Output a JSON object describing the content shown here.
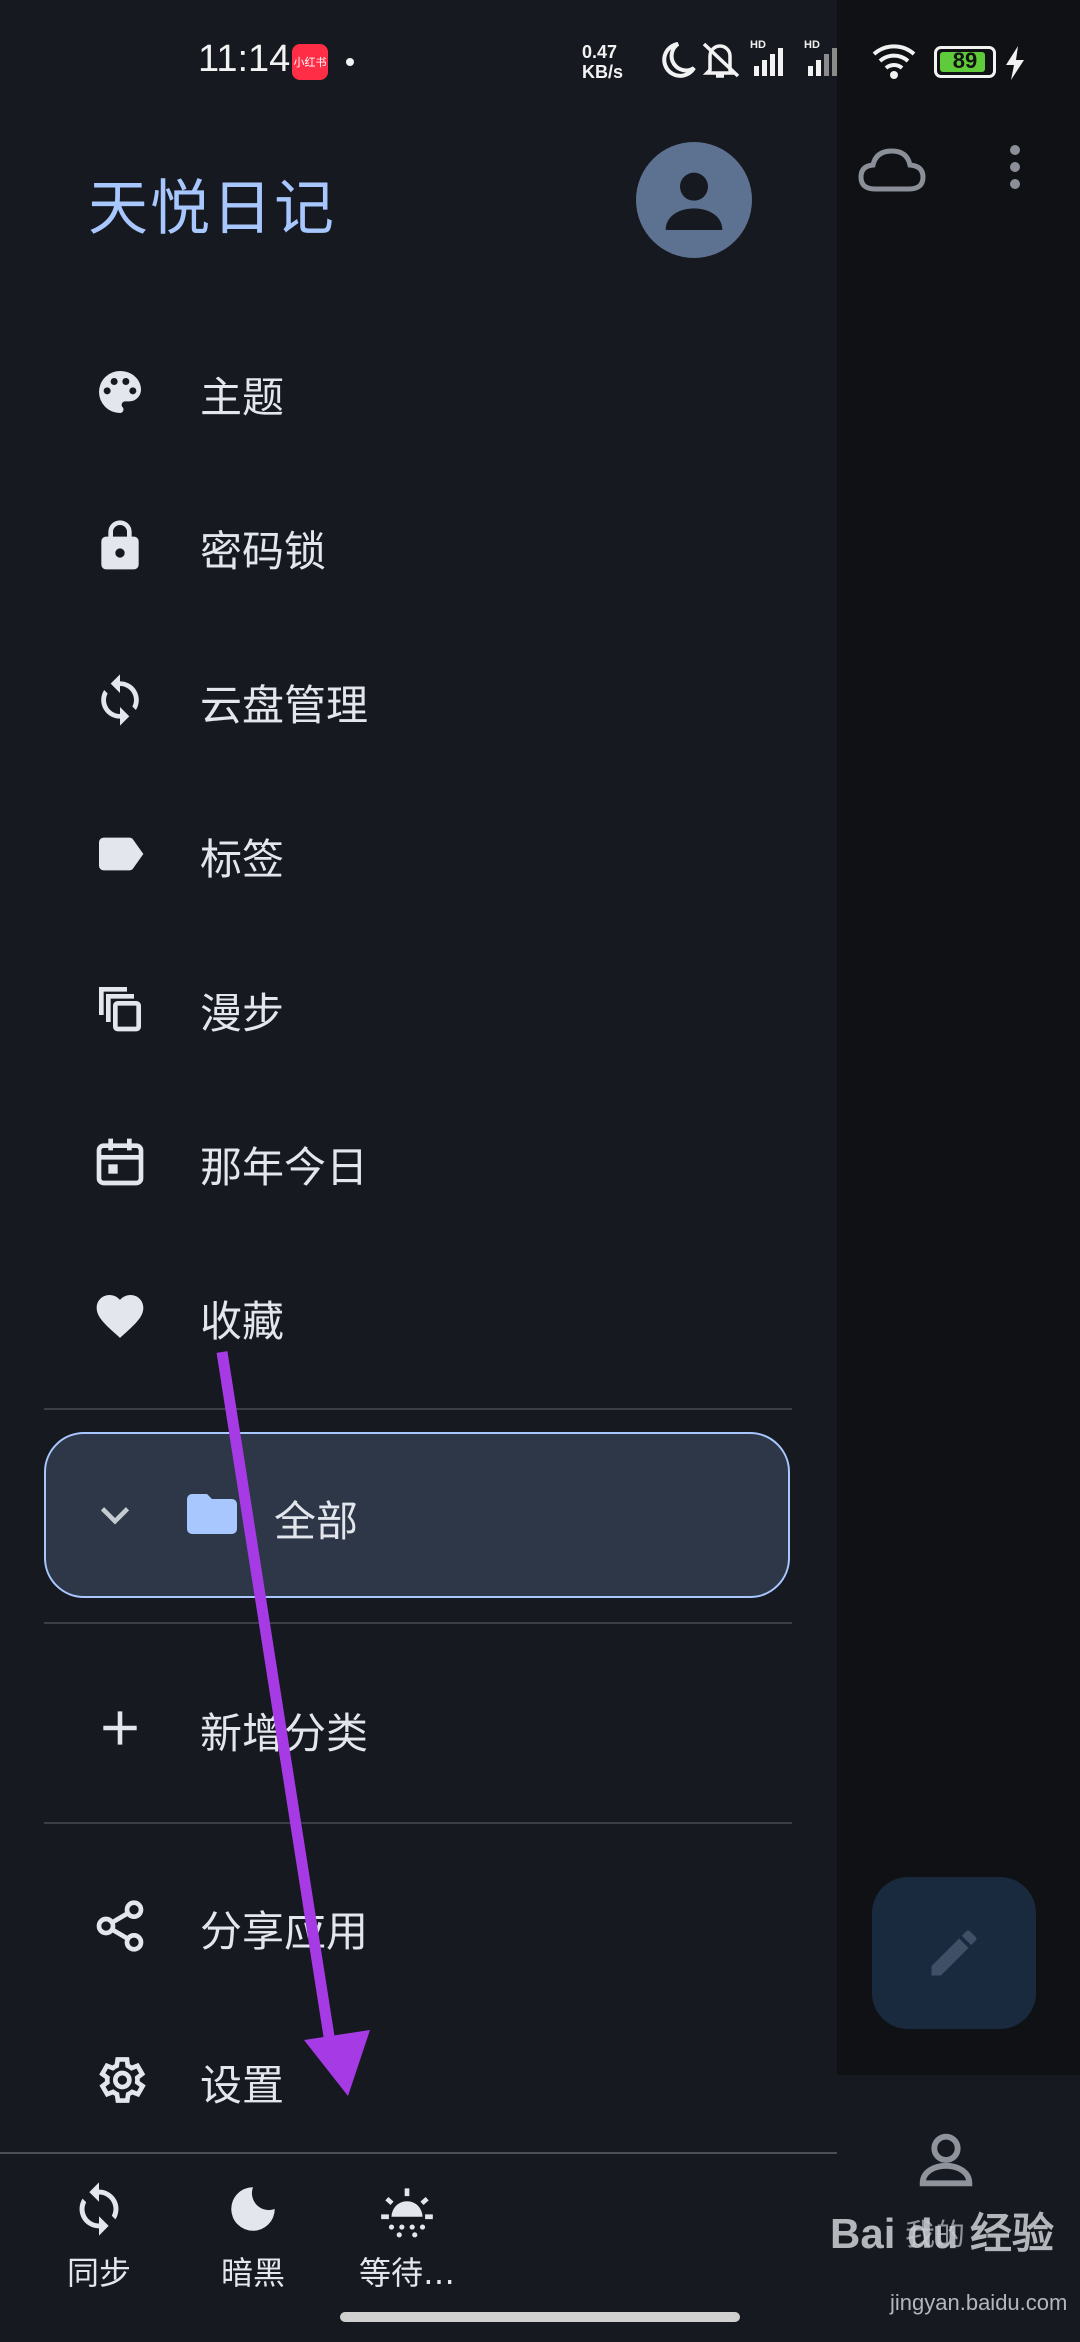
{
  "status_bar": {
    "time": "11:14",
    "app_badge": "小红书",
    "net_speed_value": "0.47",
    "net_speed_unit": "KB/s",
    "battery_level": "89",
    "battery_percent": 89,
    "signal_label_1": "HD",
    "signal_label_2": "HD"
  },
  "drawer": {
    "app_title": "天悦日记",
    "menu_items": [
      {
        "label": "主题",
        "icon": "palette-icon"
      },
      {
        "label": "密码锁",
        "icon": "lock-icon"
      },
      {
        "label": "云盘管理",
        "icon": "sync-icon"
      },
      {
        "label": "标签",
        "icon": "label-icon"
      },
      {
        "label": "漫步",
        "icon": "copy-stack-icon"
      },
      {
        "label": "那年今日",
        "icon": "calendar-icon"
      },
      {
        "label": "收藏",
        "icon": "heart-icon"
      }
    ],
    "folder": {
      "label": "全部",
      "expanded": true
    },
    "add_category_label": "新增分类",
    "share_label": "分享应用",
    "settings_label": "设置",
    "bottom_bar": [
      {
        "label": "同步",
        "icon": "sync-icon"
      },
      {
        "label": "暗黑",
        "icon": "moon-icon"
      },
      {
        "label": "等待…",
        "icon": "brightness-icon"
      }
    ]
  },
  "behind": {
    "me_label": "我的",
    "watermark": "Bai du 经验",
    "watermark_sub": "jingyan.baidu.com"
  },
  "colors": {
    "accent": "#a9c7ff",
    "background": "#16191f",
    "folder_fill": "#2d3748",
    "annotation_arrow": "#a63be6"
  }
}
